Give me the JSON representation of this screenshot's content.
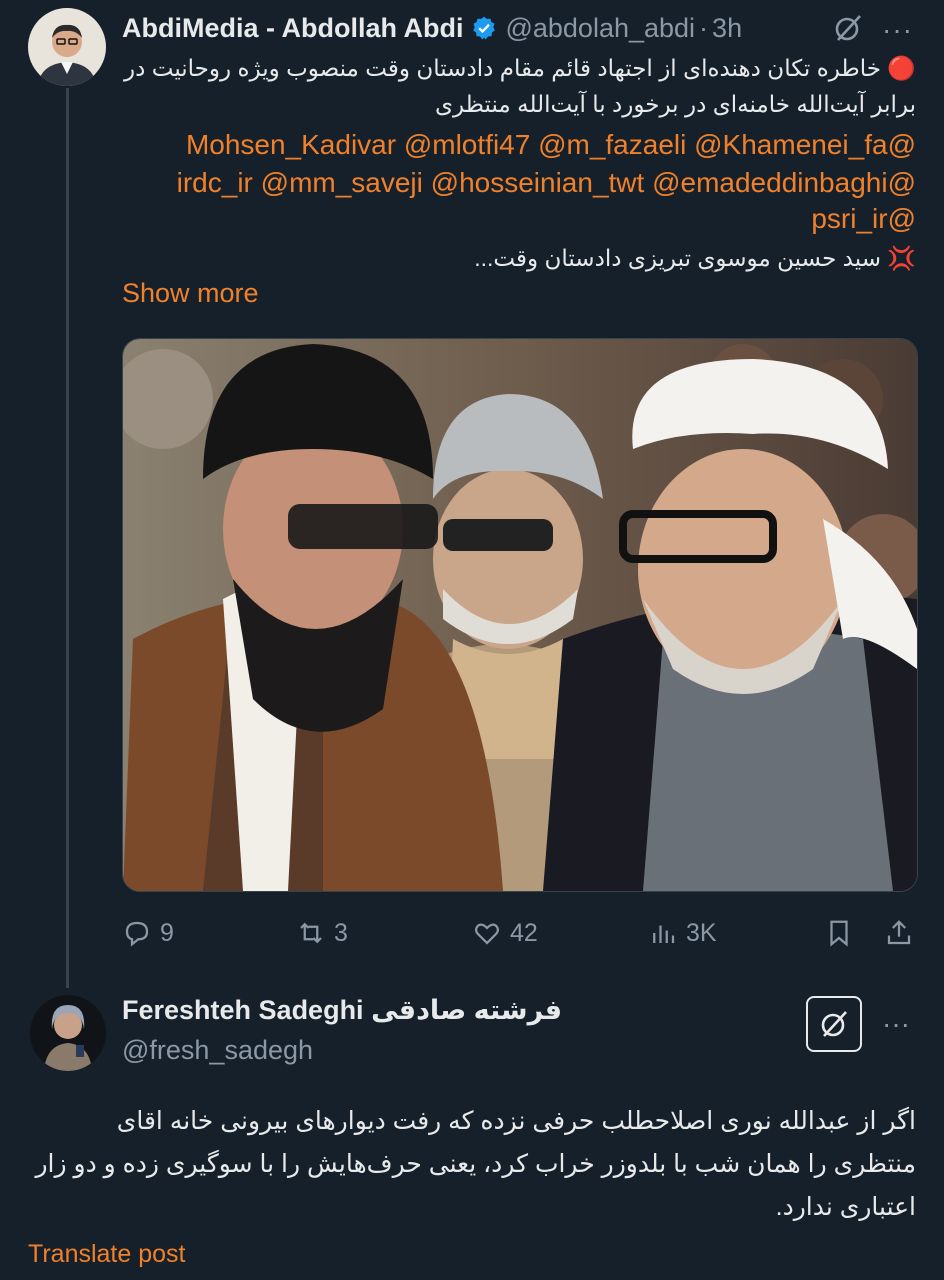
{
  "post": {
    "display_name": "AbdiMedia - Abdollah Abdi",
    "handle": "@abdolah_abdi",
    "separator": "·",
    "time": "3h",
    "more": "···",
    "line1": "🔴 خاطره تکان دهنده‌ای از اجتهاد قائم مقام دادستان وقت منصوب ویژه روحانیت در",
    "line2": "برابر آیت‌الله خامنه‌ای در برخورد با آیت‌الله منتظری",
    "mentions1": "@Mohsen_Kadivar @mlotfi47 @m_fazaeli @Khamenei_fa",
    "mentions2": "@irdc_ir @mm_saveji @hosseinian_twt @emadeddinbaghi",
    "mentions3": "@psri_ir",
    "line3": "💢 سید حسین موسوی تبریزی دادستان وقت...",
    "show_more": "Show more"
  },
  "actions": {
    "replies": "9",
    "reposts": "3",
    "likes": "42",
    "views": "3K"
  },
  "reply": {
    "display_name": "Fereshteh Sadeghi فرشته صادقی",
    "handle": "@fresh_sadegh",
    "more": "···",
    "text": "اگر از عبدالله نوری اصلاحطلب حرفی نزده که رفت دیوارهای بیرونی خانه اقای منتظری را همان شب با بلدوزر خراب کرد، یعنی حرف‌هایش را با سوگیری زده و دو زار اعتباری ندارد.",
    "translate": "Translate post"
  },
  "colors": {
    "background": "#15202b",
    "accent": "#f0812a",
    "muted": "#8b98a5",
    "verified": "#1d9bf0"
  },
  "icons": [
    "verified-badge-icon",
    "grok-icon",
    "reply-icon",
    "repost-icon",
    "like-icon",
    "views-icon",
    "bookmark-icon",
    "share-icon"
  ]
}
